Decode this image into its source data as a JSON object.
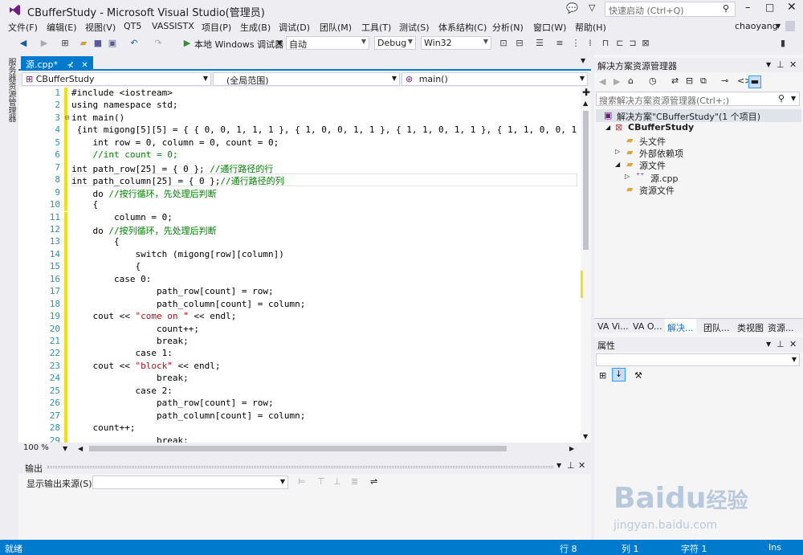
{
  "window": {
    "title": "CBufferStudy - Microsoft Visual Studio(管理员)",
    "quick_launch_placeholder": "快速启动 (Ctrl+Q)"
  },
  "menus": [
    "文件(F)",
    "编辑(E)",
    "视图(V)",
    "QT5",
    "VASSISTX",
    "项目(P)",
    "生成(B)",
    "调试(D)",
    "团队(M)",
    "工具(T)",
    "测试(S)",
    "体系结构(C)",
    "分析(N)",
    "窗口(W)",
    "帮助(H)"
  ],
  "user": "chaoyang",
  "toolbar": {
    "debugger_label": "本地 Windows 调试器",
    "mode": "自动",
    "config": "Debug",
    "platform": "Win32"
  },
  "left_strip": {
    "label": "服务器资源管理器"
  },
  "editor": {
    "tab_label": "源.cpp*",
    "tab_pin": "⊀",
    "nav": {
      "project": "CBufferStudy",
      "scope": "(全局范围)",
      "member": "main()"
    },
    "zoom": "100 %",
    "lines": [
      {
        "n": "1",
        "segs": [
          {
            "t": "#include <iostream>",
            "c": ""
          }
        ]
      },
      {
        "n": "2",
        "segs": [
          {
            "t": "using namespace std;",
            "c": ""
          }
        ]
      },
      {
        "n": "3",
        "segs": [
          {
            "t": "int main()",
            "c": ""
          }
        ]
      },
      {
        "n": "4",
        "segs": [
          {
            "t": " {int migong[5][5] = { { 0, 0, 1, 1, 1 }, { 1, 0, 0, 1, 1 }, { 1, 1, 0, 1, 1 }, { 1, 1, 0, 0, 1 },",
            "c": ""
          }
        ]
      },
      {
        "n": "5",
        "segs": [
          {
            "t": "    int row = 0, column = 0, count = 0;",
            "c": ""
          }
        ]
      },
      {
        "n": "6",
        "segs": [
          {
            "t": "    //int count = 0;",
            "c": "cmt"
          }
        ]
      },
      {
        "n": "7",
        "segs": [
          {
            "t": "int path_row[25] = { 0 }; ",
            "c": ""
          },
          {
            "t": "//通行路径的行",
            "c": "cmt"
          }
        ]
      },
      {
        "n": "8",
        "segs": [
          {
            "t": "int path_column[25] = { 0 };",
            "c": ""
          },
          {
            "t": "//通行路径的列",
            "c": "cmt"
          }
        ]
      },
      {
        "n": "9",
        "segs": [
          {
            "t": "    do ",
            "c": ""
          },
          {
            "t": "//按行循环，先处理后判断",
            "c": "cmt"
          }
        ]
      },
      {
        "n": "10",
        "segs": [
          {
            "t": "    {",
            "c": ""
          }
        ]
      },
      {
        "n": "11",
        "segs": [
          {
            "t": "        column = 0;",
            "c": ""
          }
        ]
      },
      {
        "n": "12",
        "segs": [
          {
            "t": "    do ",
            "c": ""
          },
          {
            "t": "//按列循环，先处理后判断",
            "c": "cmt"
          }
        ]
      },
      {
        "n": "13",
        "segs": [
          {
            "t": "        {",
            "c": ""
          }
        ]
      },
      {
        "n": "14",
        "segs": [
          {
            "t": "            switch (migong[row][column])",
            "c": ""
          }
        ]
      },
      {
        "n": "15",
        "segs": [
          {
            "t": "            {",
            "c": ""
          }
        ]
      },
      {
        "n": "16",
        "segs": [
          {
            "t": "        case 0:",
            "c": ""
          }
        ]
      },
      {
        "n": "17",
        "segs": [
          {
            "t": "                path_row[count] = row;",
            "c": ""
          }
        ]
      },
      {
        "n": "18",
        "segs": [
          {
            "t": "                path_column[count] = column;",
            "c": ""
          }
        ]
      },
      {
        "n": "19",
        "segs": [
          {
            "t": "    cout << ",
            "c": ""
          },
          {
            "t": "\"come on \"",
            "c": "str"
          },
          {
            "t": " << endl;",
            "c": ""
          }
        ]
      },
      {
        "n": "20",
        "segs": [
          {
            "t": "                count++;",
            "c": ""
          }
        ]
      },
      {
        "n": "21",
        "segs": [
          {
            "t": "                break;",
            "c": ""
          }
        ]
      },
      {
        "n": "22",
        "segs": [
          {
            "t": "            case 1:",
            "c": ""
          }
        ]
      },
      {
        "n": "23",
        "segs": [
          {
            "t": "    cout << ",
            "c": ""
          },
          {
            "t": "\"block\"",
            "c": "str"
          },
          {
            "t": " << endl;",
            "c": ""
          }
        ]
      },
      {
        "n": "24",
        "segs": [
          {
            "t": "                break;",
            "c": ""
          }
        ]
      },
      {
        "n": "25",
        "segs": [
          {
            "t": "            case 2:",
            "c": ""
          }
        ]
      },
      {
        "n": "26",
        "segs": [
          {
            "t": "                path_row[count] = row;",
            "c": ""
          }
        ]
      },
      {
        "n": "27",
        "segs": [
          {
            "t": "                path_column[count] = column;",
            "c": ""
          }
        ]
      },
      {
        "n": "28",
        "segs": [
          {
            "t": "    count++;",
            "c": ""
          }
        ]
      },
      {
        "n": "29",
        "segs": [
          {
            "t": "                break;",
            "c": ""
          }
        ]
      }
    ]
  },
  "output": {
    "title": "输出",
    "source_label": "显示输出来源(S):"
  },
  "solution_explorer": {
    "title": "解决方案资源管理器",
    "search_placeholder": "搜索解决方案资源管理器(Ctrl+;)",
    "tree": [
      {
        "label": "解决方案\"CBufferStudy\"(1 个项目)",
        "bold": false
      },
      {
        "label": "CBufferStudy",
        "bold": true
      },
      {
        "label": "头文件",
        "bold": false
      },
      {
        "label": "外部依赖项",
        "bold": false
      },
      {
        "label": "源文件",
        "bold": false
      },
      {
        "label": "源.cpp",
        "bold": false
      },
      {
        "label": "资源文件",
        "bold": false
      }
    ],
    "tabs": [
      "VA Vi...",
      "VA O...",
      "解决...",
      "团队...",
      "类视图",
      "资源..."
    ]
  },
  "properties": {
    "title": "属性"
  },
  "status": {
    "ready": "就绪",
    "line": "行 8",
    "col": "列 1",
    "char": "字符 1",
    "mode": "Ins"
  },
  "watermark": {
    "brand": "Baidu",
    "brand_cn": "经验",
    "url": "jingyan.baidu.com"
  },
  "colors": {
    "accent": "#007acc",
    "comment": "#008000",
    "string": "#a31515",
    "line_number": "#2b91af",
    "change_bar": "#f1e500"
  }
}
